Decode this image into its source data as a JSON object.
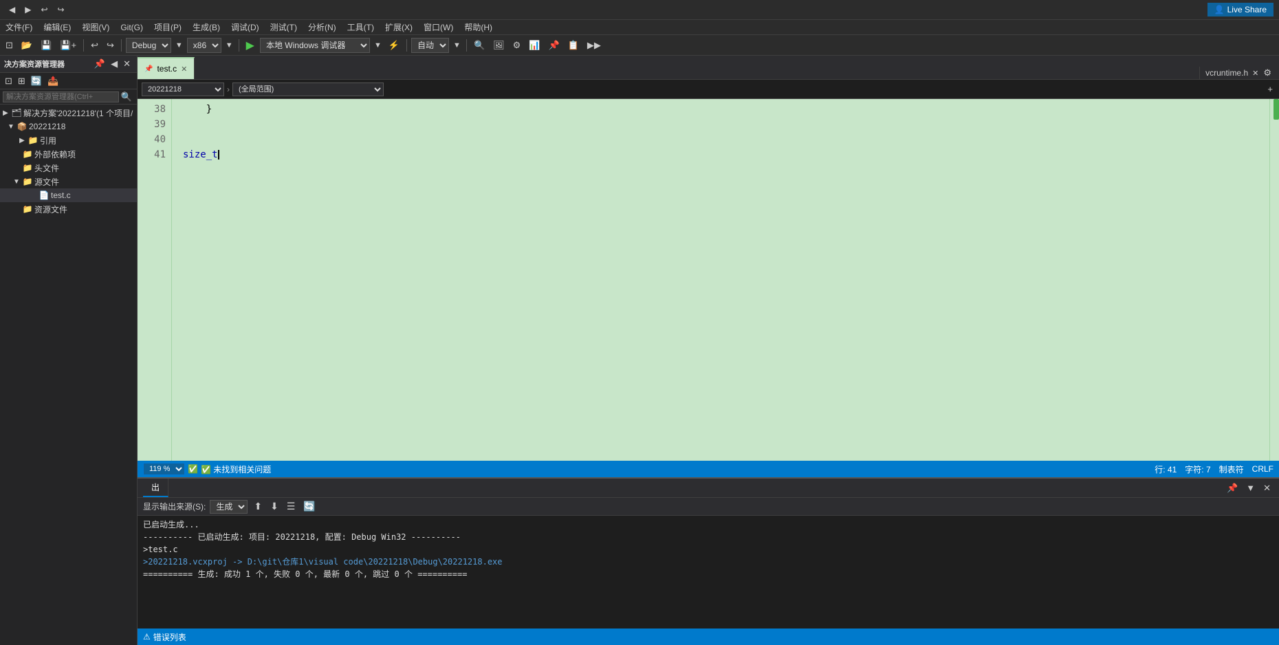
{
  "titlebar": {
    "left_buttons": [
      "◀",
      "▶",
      "↩",
      "↪"
    ],
    "nav_icons": [
      "⊡",
      "▷",
      "◁"
    ],
    "undo_redo": [
      "↩",
      "↪"
    ],
    "live_share_label": "Live Share"
  },
  "menubar": {
    "items": [
      "文件(F)",
      "编辑(E)",
      "视图(V)",
      "Git(G)",
      "项目(P)",
      "生成(B)",
      "调试(D)",
      "测试(T)",
      "分析(N)",
      "工具(T)",
      "扩展(X)",
      "窗口(W)",
      "帮助(H)"
    ]
  },
  "toolbar": {
    "config_label": "Debug",
    "platform_label": "x86",
    "run_label": "▶",
    "run_text": "本地 Windows 调试器",
    "auto_label": "自动",
    "search_icon": "🔍"
  },
  "sidebar": {
    "title": "决方案资源管理器",
    "search_placeholder": "解决方案资源管理器(Ctrl+",
    "solution_label": "解决方案'20221218'(1 个项目/",
    "project_label": "20221218",
    "tree_items": [
      {
        "label": "引用",
        "indent": 2,
        "has_arrow": true,
        "icon": "📁"
      },
      {
        "label": "外部依赖项",
        "indent": 1,
        "has_arrow": false,
        "icon": "📁"
      },
      {
        "label": "头文件",
        "indent": 1,
        "has_arrow": false,
        "icon": "📁"
      },
      {
        "label": "源文件",
        "indent": 1,
        "has_arrow": true,
        "icon": "📁"
      },
      {
        "label": "test.c",
        "indent": 3,
        "has_arrow": false,
        "icon": "📄"
      },
      {
        "label": "资源文件",
        "indent": 1,
        "has_arrow": false,
        "icon": "📁"
      }
    ]
  },
  "editor": {
    "active_tab": "test.c",
    "active_tab_pin": "📌",
    "second_tab": "vcruntime.h",
    "breadcrumb_file": "20221218",
    "breadcrumb_scope": "(全局范围)",
    "line_numbers": [
      "38",
      "39",
      "40",
      "41"
    ],
    "code_lines": [
      "    }",
      "",
      "",
      "    size_t"
    ],
    "zoom_level": "119 %",
    "status_text": "✅ 未找到相关问题",
    "cursor_line": "行: 41",
    "cursor_char": "字符: 7",
    "encoding": "制表符",
    "line_ending": "CRLF"
  },
  "output_panel": {
    "header_label": "出",
    "show_output_label": "显示输出来源(S):",
    "output_source": "生成",
    "lines": [
      "已启动生成...",
      "---------- 已启动生成: 项目: 20221218, 配置: Debug Win32 ----------",
      ">test.c",
      ">20221218.vcxproj -> D:\\git\\仓库1\\visual code\\20221218\\Debug\\20221218.exe",
      "========== 生成: 成功 1 个, 失败 0 个, 最新 0 个, 跳过 0 个 =========="
    ]
  },
  "error_panel": {
    "label": "错误列表"
  }
}
